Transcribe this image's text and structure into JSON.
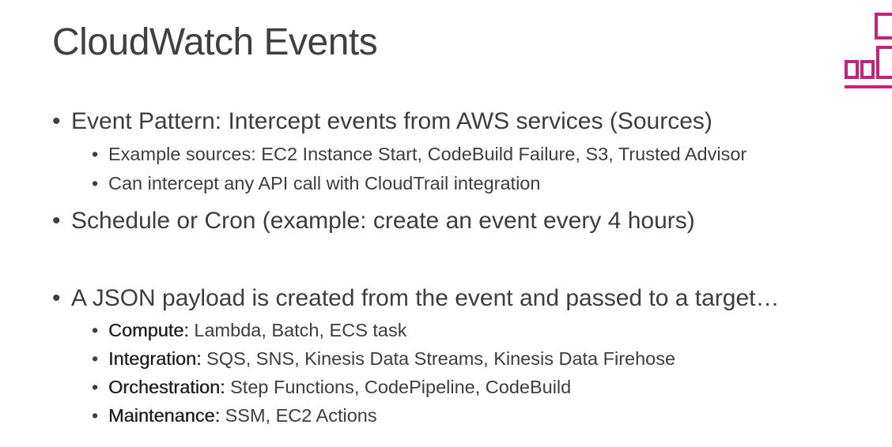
{
  "slide": {
    "title": "CloudWatch Events",
    "bullet_char": "•",
    "accent_color": "#c7227a",
    "logo_icon": "cloudwatch-bar-chart-icon"
  },
  "content": {
    "b1": "Event Pattern: Intercept events from AWS services (Sources)",
    "b1_sub1": "Example sources: EC2 Instance Start, CodeBuild Failure, S3, Trusted Advisor",
    "b1_sub2": "Can intercept any API call with CloudTrail integration",
    "b2": "Schedule or Cron (example: create an event every 4 hours)",
    "b3": "A JSON payload is created from the event and passed to a target…",
    "targets": [
      {
        "label": "Compute:",
        "text": " Lambda, Batch, ECS task"
      },
      {
        "label": "Integration:",
        "text": " SQS, SNS, Kinesis Data Streams, Kinesis Data Firehose"
      },
      {
        "label": "Orchestration:",
        "text": " Step Functions, CodePipeline, CodeBuild"
      },
      {
        "label": "Maintenance:",
        "text": " SSM, EC2 Actions"
      }
    ]
  }
}
